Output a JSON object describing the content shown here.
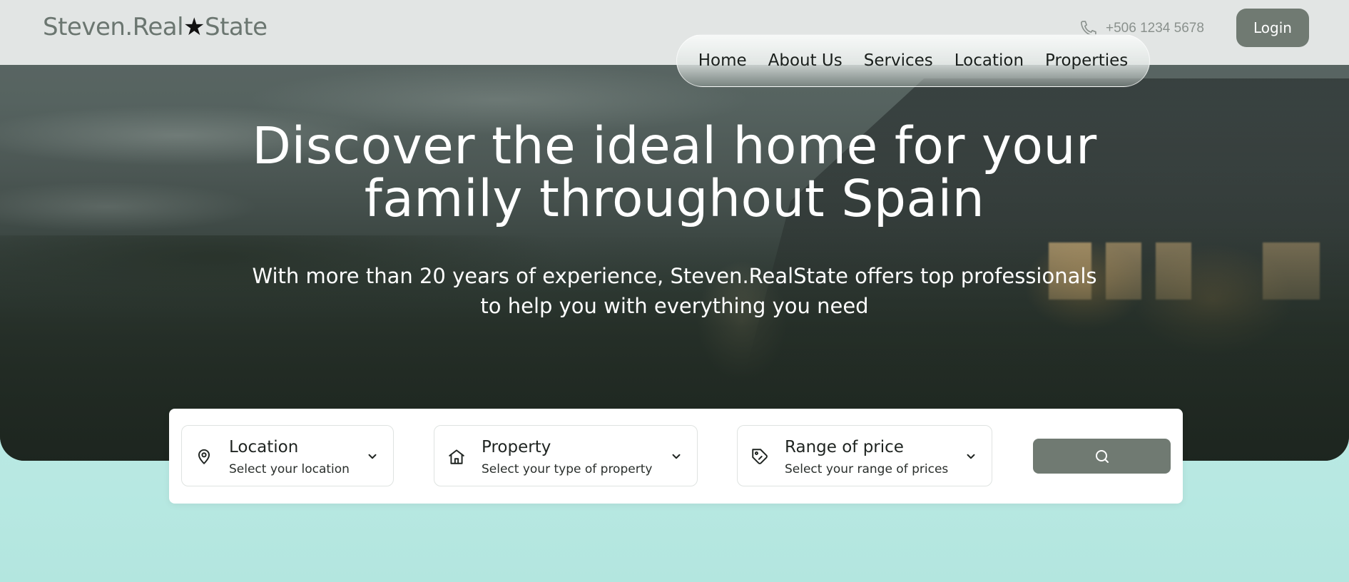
{
  "brand": {
    "name_part1": "Steven.Real",
    "star": "★",
    "name_part2": "State"
  },
  "header": {
    "phone": "+506 1234 5678",
    "login_label": "Login",
    "icons": {
      "phone": "phone-icon"
    }
  },
  "nav": {
    "items": [
      {
        "label": "Home"
      },
      {
        "label": "About Us"
      },
      {
        "label": "Services"
      },
      {
        "label": "Location"
      },
      {
        "label": "Properties"
      }
    ]
  },
  "hero": {
    "title_line1": "Discover the ideal home for your",
    "title_line2": "family throughout Spain",
    "subtitle_line1": "With more than 20 years of experience, Steven.RealState offers top professionals",
    "subtitle_line2": "to help you with everything you need"
  },
  "search": {
    "location": {
      "label": "Location",
      "placeholder": "Select your location",
      "icon": "location-pin-icon"
    },
    "property": {
      "label": "Property",
      "placeholder": "Select your type of property",
      "icon": "house-icon"
    },
    "price": {
      "label": "Range of price",
      "placeholder": "Select your range of prices",
      "icon": "price-tag-icon"
    },
    "button_icon": "search-icon"
  },
  "colors": {
    "accent": "#707a72",
    "header_bg": "#e8eae9",
    "page_bg": "#c4efec",
    "logo_text": "#6b7670"
  }
}
